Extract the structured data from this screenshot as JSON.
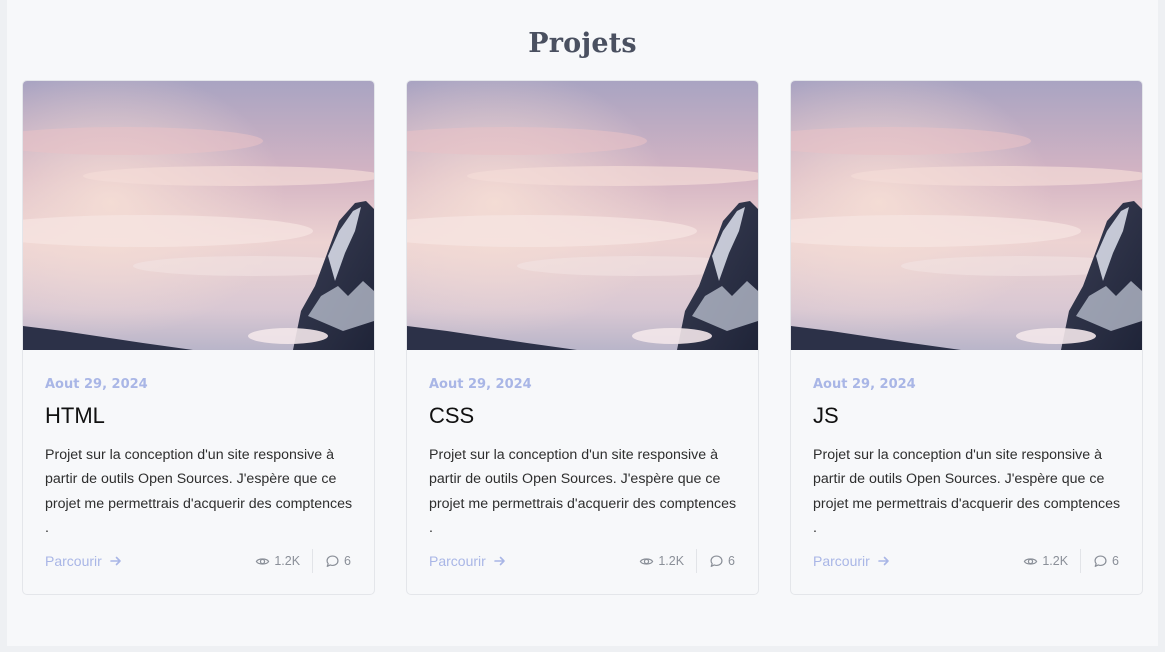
{
  "section": {
    "title": "Projets"
  },
  "cards": [
    {
      "date": "Aout 29, 2024",
      "title": "HTML",
      "description": "Projet sur la conception d'un site responsive à partir de outils Open Sources. J'espère que ce projet me permettrais d'acquerir des comptences .",
      "link_label": "Parcourir",
      "views": "1.2K",
      "comments": "6"
    },
    {
      "date": "Aout 29, 2024",
      "title": "CSS",
      "description": "Projet sur la conception d'un site responsive à partir de outils Open Sources. J'espère que ce projet me permettrais d'acquerir des comptences .",
      "link_label": "Parcourir",
      "views": "1.2K",
      "comments": "6"
    },
    {
      "date": "Aout 29, 2024",
      "title": "JS",
      "description": "Projet sur la conception d'un site responsive à partir de outils Open Sources. J'espère que ce projet me permettrais d'acquerir des comptences .",
      "link_label": "Parcourir",
      "views": "1.2K",
      "comments": "6"
    }
  ],
  "colors": {
    "accent": "#a9b6e6",
    "title": "#4a5060",
    "meta": "#8a8f98"
  },
  "icons": {
    "link": "arrow-right-icon",
    "views": "eye-icon",
    "comments": "comment-bubble-icon"
  }
}
